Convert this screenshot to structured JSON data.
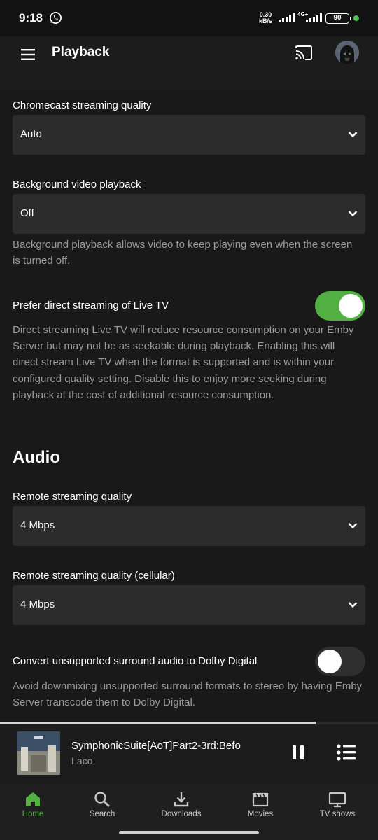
{
  "status_bar": {
    "time": "9:18",
    "net_speed_value": "0.30",
    "net_speed_unit": "kB/s",
    "network_type": "4G+",
    "battery": "90"
  },
  "app_bar": {
    "title": "Playback"
  },
  "settings": {
    "chromecast_quality": {
      "label": "Chromecast streaming quality",
      "value": "Auto"
    },
    "background_playback": {
      "label": "Background video playback",
      "value": "Off",
      "help": "Background playback allows video to keep playing even when the screen is turned off."
    },
    "prefer_direct_live_tv": {
      "label": "Prefer direct streaming of Live TV",
      "enabled": true,
      "help": "Direct streaming Live TV will reduce resource consumption on your Emby Server but may not be as seekable during playback. Enabling this will direct stream Live TV when the format is supported and is within your configured quality setting. Disable this to enjoy more seeking during playback at the cost of additional resource consumption."
    },
    "audio_section_title": "Audio",
    "remote_quality": {
      "label": "Remote streaming quality",
      "value": "4 Mbps"
    },
    "remote_quality_cellular": {
      "label": "Remote streaming quality (cellular)",
      "value": "4 Mbps"
    },
    "convert_surround": {
      "label": "Convert unsupported surround audio to Dolby Digital",
      "enabled": false,
      "help": "Avoid downmixing unsupported surround formats to stereo by having Emby Server transcode them to Dolby Digital."
    }
  },
  "now_playing": {
    "title": "SymphonicSuite[AoT]Part2-3rd:Befo",
    "artist": "Laco",
    "progress_fraction": 0.835
  },
  "bottom_nav": {
    "items": [
      {
        "label": "Home",
        "icon": "home-icon",
        "active": true
      },
      {
        "label": "Search",
        "icon": "search-icon",
        "active": false
      },
      {
        "label": "Downloads",
        "icon": "download-icon",
        "active": false
      },
      {
        "label": "Movies",
        "icon": "movies-icon",
        "active": false
      },
      {
        "label": "TV shows",
        "icon": "tv-icon",
        "active": false
      }
    ]
  },
  "colors": {
    "accent": "#52b043",
    "background": "#191919",
    "field_background": "#2c2c2c",
    "secondary_text": "#9a9a9a"
  }
}
